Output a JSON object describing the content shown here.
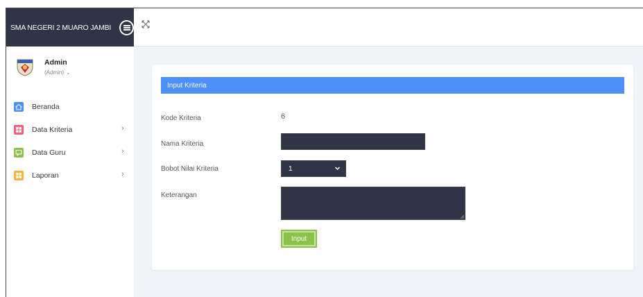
{
  "brand": {
    "name": "SMA NEGERI 2 MUARO JAMBI"
  },
  "user": {
    "name": "Admin",
    "role": "(Admin)"
  },
  "sidebar": {
    "items": [
      {
        "label": "Beranda",
        "icon": "home-icon",
        "color": "#4b8ff9",
        "has_submenu": false
      },
      {
        "label": "Data Kriteria",
        "icon": "grid-icon",
        "color": "#f5607a",
        "has_submenu": true
      },
      {
        "label": "Data Guru",
        "icon": "chat-icon",
        "color": "#8bc34a",
        "has_submenu": true
      },
      {
        "label": "Laporan",
        "icon": "grid-icon",
        "color": "#f6b53f",
        "has_submenu": true
      }
    ]
  },
  "form": {
    "title": "Input Kriteria",
    "kode_label": "Kode Kriteria",
    "kode_value": "6",
    "nama_label": "Nama Kriteria",
    "nama_value": "",
    "bobot_label": "Bobot Nilai Kriteria",
    "bobot_value": "1",
    "keterangan_label": "Keterangan",
    "keterangan_value": "",
    "submit_label": "Input"
  },
  "colors": {
    "sidebar_header": "#2f3447",
    "card_header": "#4b8ff9",
    "submit": "#8bc34a",
    "field_bg": "#2f3447"
  }
}
